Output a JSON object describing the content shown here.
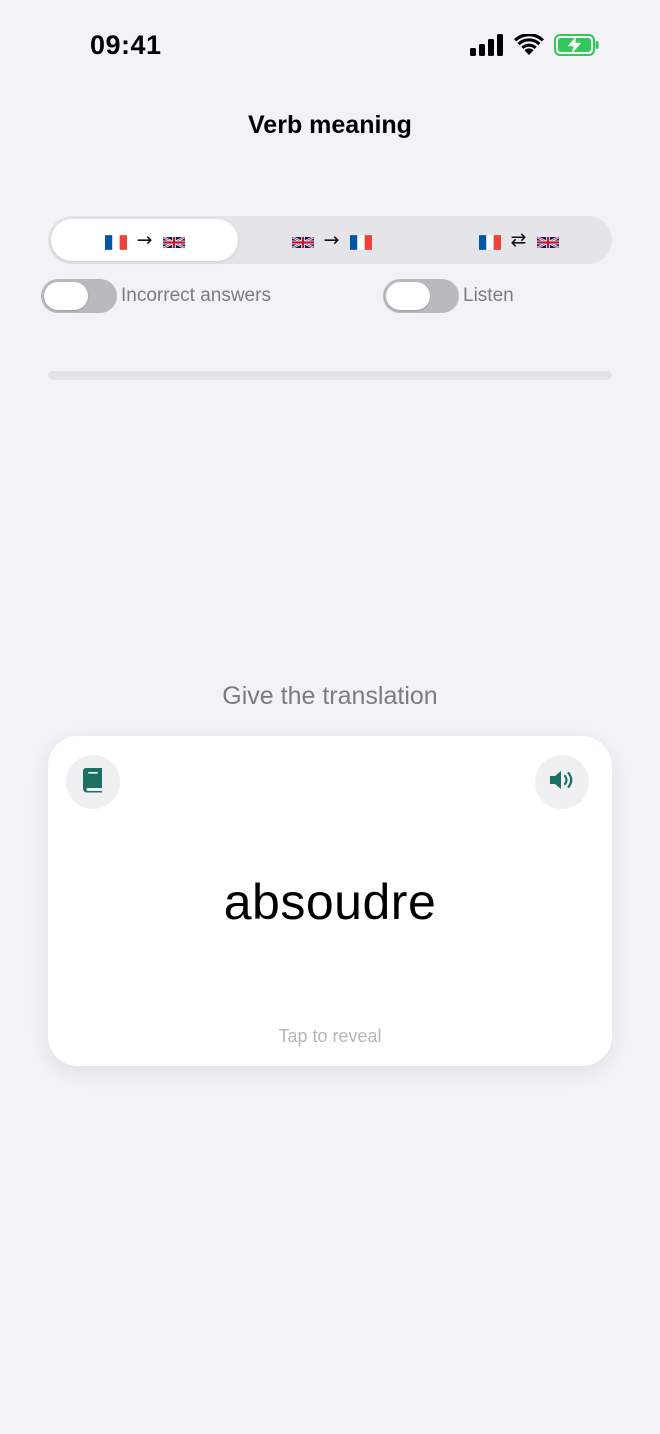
{
  "status_bar": {
    "time": "09:41",
    "icons": [
      "signal-icon",
      "wifi-icon",
      "battery-charging-icon"
    ],
    "battery_color": "#34c759"
  },
  "header": {
    "title": "Verb meaning"
  },
  "direction_selector": {
    "options": [
      {
        "from_flag": "france-flag-icon",
        "arrow": "→",
        "to_flag": "uk-flag-icon",
        "selected": true
      },
      {
        "from_flag": "uk-flag-icon",
        "arrow": "→",
        "to_flag": "france-flag-icon",
        "selected": false
      },
      {
        "from_flag": "france-flag-icon",
        "arrow": "⇄",
        "to_flag": "uk-flag-icon",
        "selected": false
      }
    ]
  },
  "toggles": {
    "incorrect_answers": {
      "label": "Incorrect answers",
      "on": false
    },
    "listen": {
      "label": "Listen",
      "on": false
    }
  },
  "progress": {
    "value": 0
  },
  "prompt": "Give the translation",
  "card": {
    "word": "absoudre",
    "hint": "Tap to reveal",
    "left_button_icon": "book-icon",
    "right_button_icon": "speaker-icon",
    "accent_color": "#1c6f63"
  }
}
